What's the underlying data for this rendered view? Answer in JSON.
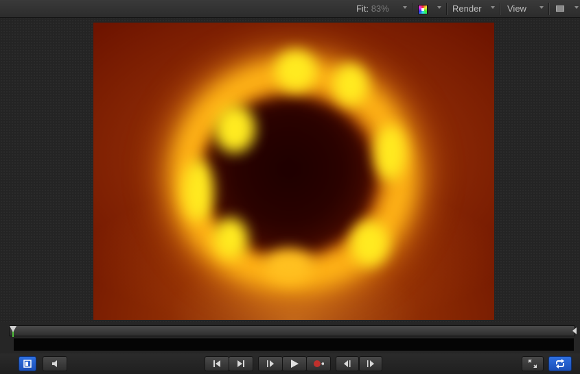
{
  "header": {
    "fit_label": "Fit:",
    "fit_value": "83%",
    "render_label": "Render",
    "view_label": "View",
    "icons": [
      "color-channels-icon",
      "layout-icon"
    ]
  },
  "canvas": {
    "content": "blurred fire ring render",
    "colors": {
      "ring": "#ffb316",
      "ring_hot": "#ffea20",
      "background": "#8c2a05",
      "core": "#1e0000"
    }
  },
  "timeline": {
    "playhead_color": "#4fbf3a"
  },
  "transport": {
    "buttons": [
      "show-hide-timeline-icon",
      "mute-audio-icon",
      "go-to-start-icon",
      "go-to-end-icon",
      "play-from-start-icon",
      "play-icon",
      "record-icon",
      "previous-frame-icon",
      "next-frame-icon",
      "fullscreen-icon",
      "loop-playback-icon"
    ],
    "accent_color": "#2e6fe0"
  }
}
